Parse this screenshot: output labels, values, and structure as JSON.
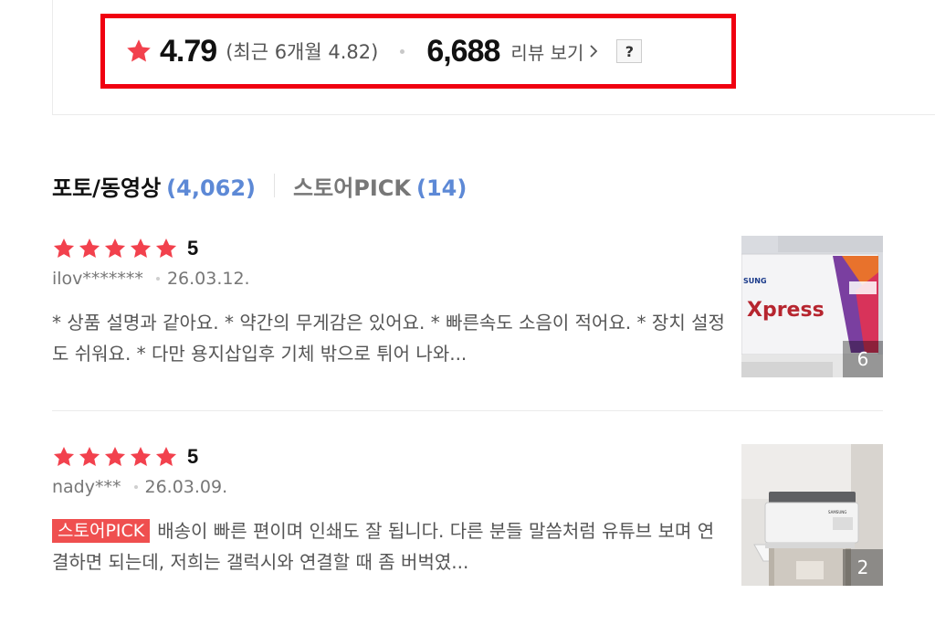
{
  "summary": {
    "avg_rating": "4.79",
    "recent_rating": "(최근 6개월 4.82)",
    "review_count": "6,688",
    "view_reviews_label": "리뷰 보기",
    "help_label": "?"
  },
  "tabs": [
    {
      "label": "포토/동영상",
      "count": "(4,062)"
    },
    {
      "label": "스토어PICK",
      "count": "(14)"
    }
  ],
  "reviews": [
    {
      "rating": 5,
      "score": "5",
      "user": "ilov*******",
      "date": "26.03.12.",
      "badge": "",
      "text": "* 상품 설명과 같아요. * 약간의 무게감은 있어요. * 빠른속도 소음이 적어요. * 장치 설정도 쉬워요. * 다만 용지삽입후 기체 밖으로 튀어 나와...",
      "photo_count": "6",
      "thumb_brand": "SUNG",
      "thumb_title": "Xpress"
    },
    {
      "rating": 5,
      "score": "5",
      "user": "nady***",
      "date": "26.03.09.",
      "badge": "스토어PICK",
      "text": "배송이 빠른 편이며 인쇄도 잘 됩니다. 다른 분들 말씀처럼 유튜브 보며 연결하면 되는데, 저희는 갤럭시와 연결할 때 좀 버벅였...",
      "photo_count": "2",
      "thumb_brand": "SAMSUNG"
    }
  ],
  "colors": {
    "star": "#f2414d",
    "highlight_border": "#f00010",
    "tab_count": "#5d89d6",
    "badge": "#ef4f4f"
  }
}
